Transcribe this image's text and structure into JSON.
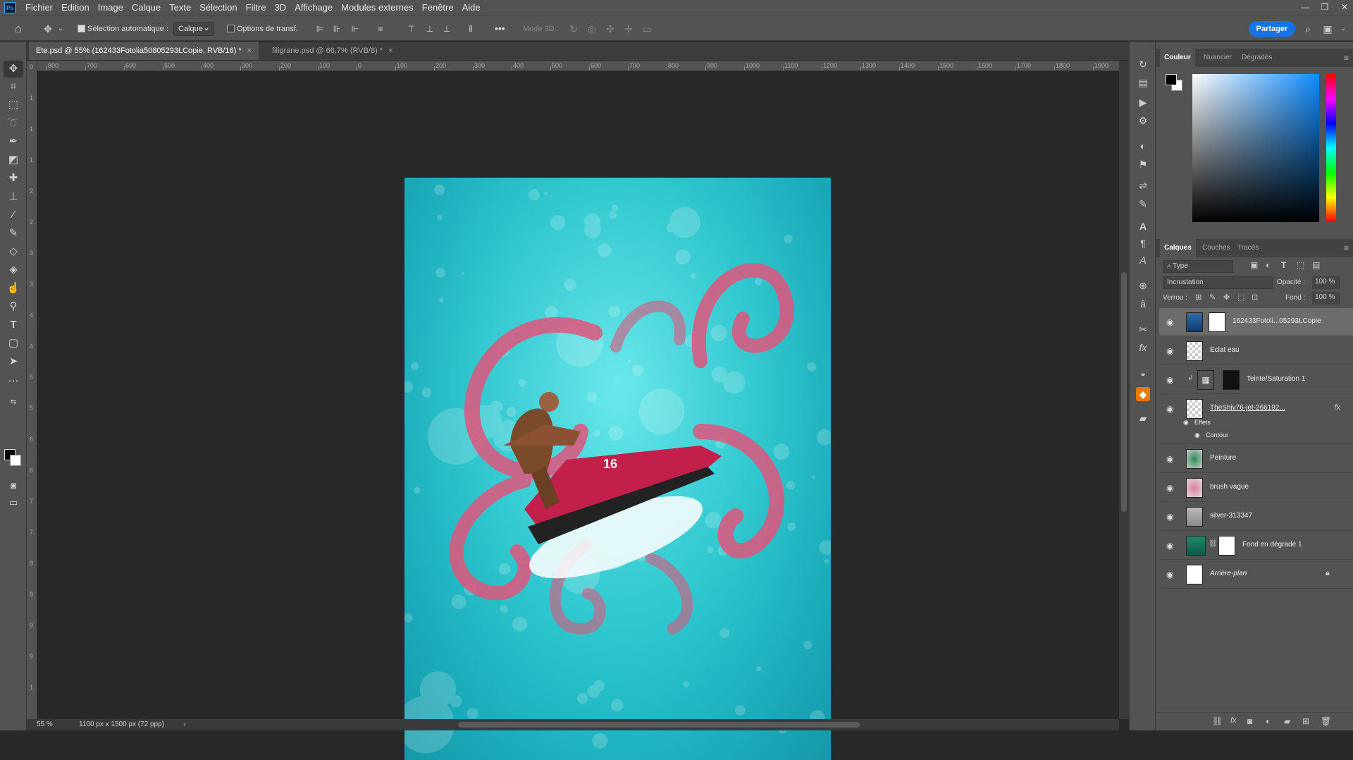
{
  "menu": [
    "Fichier",
    "Edition",
    "Image",
    "Calque",
    "Texte",
    "Sélection",
    "Filtre",
    "3D",
    "Affichage",
    "Modules externes",
    "Fenêtre",
    "Aide"
  ],
  "app_icon": "Ps",
  "window_controls": {
    "minimize": "—",
    "restore": "❐",
    "close": "✕"
  },
  "options": {
    "auto_select_label": "Sélection automatique :",
    "auto_select_value": "Calque",
    "transform_label": "Options de transf.",
    "mode3d_label": "Mode 3D :",
    "more": "•••",
    "share": "Partager"
  },
  "tabs": [
    {
      "label": "Ete.psd @ 55% (162433Fotolia50805293LCopie, RVB/16) *",
      "close": "×"
    },
    {
      "label": "filigrane.psd @ 66,7% (RVB/8) *",
      "close": "×"
    }
  ],
  "ruler_h_labels": [
    "800",
    "700",
    "600",
    "500",
    "400",
    "300",
    "200",
    "100",
    "0",
    "100",
    "200",
    "300",
    "400",
    "500",
    "600",
    "700",
    "800",
    "900",
    "1000",
    "1100",
    "1200",
    "1300",
    "1400",
    "1500",
    "1600",
    "1700",
    "1800",
    "1900"
  ],
  "ruler_v_labels": [
    "0",
    "1",
    "1",
    "1",
    "2",
    "2",
    "3",
    "3",
    "4",
    "4",
    "5",
    "5",
    "6",
    "6",
    "7",
    "7",
    "8",
    "8",
    "9",
    "9",
    "1"
  ],
  "status": {
    "zoom": "55 %",
    "doc_info": "1100 px x 1500 px (72 ppp)"
  },
  "color_panel": {
    "tabs": [
      "Couleur",
      "Nuancier",
      "Dégradés"
    ]
  },
  "layers_panel": {
    "tabs": [
      "Calques",
      "Couches",
      "Tracés"
    ],
    "filter": "Type",
    "blend_mode": "Incrustation",
    "opacity_label": "Opacité :",
    "opacity_value": "100 %",
    "lock_label": "Verrou :",
    "fill_label": "Fond :",
    "fill_value": "100 %",
    "layers": [
      {
        "name": "162433Fotoli...05293LCopie"
      },
      {
        "name": "Eclat eau"
      },
      {
        "name": "Teinte/Saturation 1"
      },
      {
        "name": "TheShiv76-jet-266192..."
      },
      {
        "name": "Peinture"
      },
      {
        "name": "brush vague"
      },
      {
        "name": "silver-313347"
      },
      {
        "name": "Fond en dégradé 1"
      },
      {
        "name": "Arrière-plan"
      }
    ],
    "effects_label": "Effets",
    "contour_label": "Contour"
  },
  "artwork": {
    "jetski_number": "16"
  },
  "colors": {
    "share_blue": "#1473e6",
    "panel_bg": "#535353",
    "canvas_bg": "#282828",
    "cyan": "#2cc9d0",
    "tentacle_pink": "#e0557c"
  }
}
